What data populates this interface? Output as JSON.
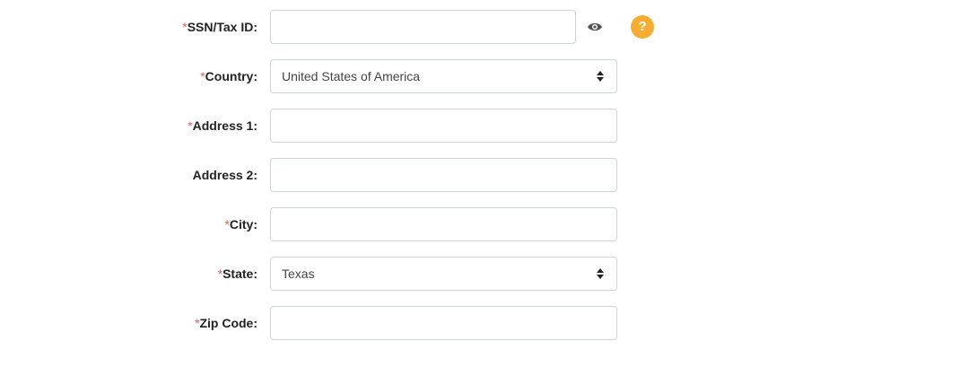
{
  "form": {
    "fields": [
      {
        "required_mark": "*",
        "label": "SSN/Tax ID:",
        "value": ""
      },
      {
        "required_mark": "*",
        "label": "Country:",
        "value": "United States of America"
      },
      {
        "required_mark": "*",
        "label": "Address 1:",
        "value": ""
      },
      {
        "required_mark": "",
        "label": "Address 2:",
        "value": ""
      },
      {
        "required_mark": "*",
        "label": "City:",
        "value": ""
      },
      {
        "required_mark": "*",
        "label": "State:",
        "value": "Texas"
      },
      {
        "required_mark": "*",
        "label": "Zip Code:",
        "value": ""
      }
    ],
    "help_icon": "?",
    "icons": [
      "eye-icon",
      "help-icon",
      "select-caret-icon"
    ]
  },
  "colors": {
    "required_mark": "#e35d5d",
    "help_badge": "#f5ad33",
    "field_border": "#cfd4da"
  }
}
